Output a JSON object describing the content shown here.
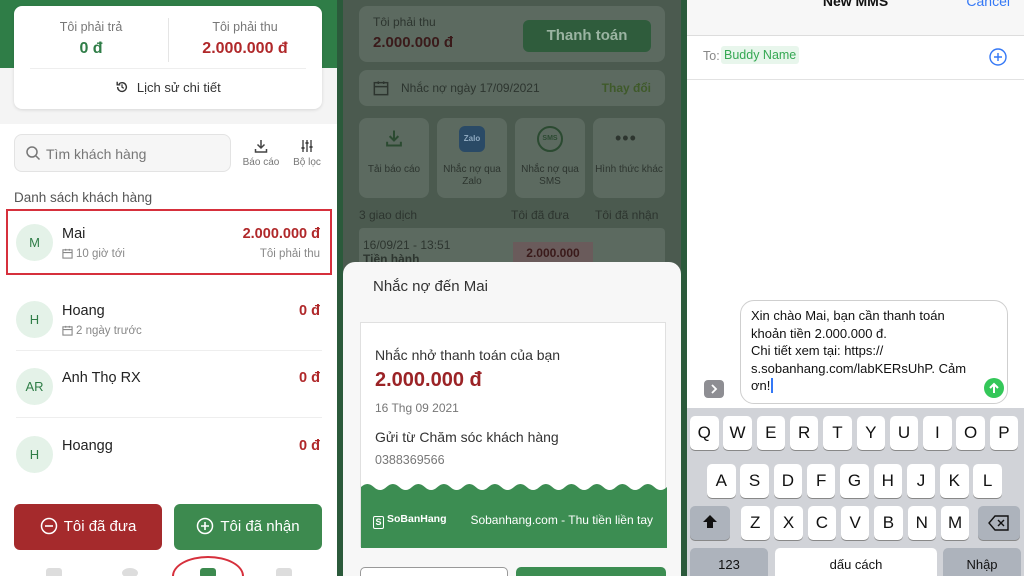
{
  "panel1": {
    "summary": {
      "pay_label": "Tôi phải trả",
      "pay_value": "0 đ",
      "receive_label": "Tôi phải thu",
      "receive_value": "2.000.000 đ",
      "history_label": "Lịch sử chi tiết"
    },
    "search_placeholder": "Tìm khách hàng",
    "tools": [
      {
        "label": "Báo cáo",
        "icon": "download-icon"
      },
      {
        "label": "Bộ lọc",
        "icon": "filter-icon"
      }
    ],
    "list_title": "Danh sách khách hàng",
    "customers": [
      {
        "initials": "M",
        "name": "Mai",
        "sub": "10 giờ tới",
        "amount": "2.000.000 đ",
        "note": "Tôi phải thu"
      },
      {
        "initials": "H",
        "name": "Hoang",
        "sub": "2 ngày trước",
        "amount": "0 đ"
      },
      {
        "initials": "AR",
        "name": "Anh Thọ RX",
        "amount": "0 đ"
      },
      {
        "initials": "H",
        "name": "Hoangg",
        "amount": "0 đ"
      }
    ],
    "buttons": {
      "gave": "Tôi đã đưa",
      "received": "Tôi đã nhận"
    },
    "colors": {
      "primary": "#2f7d47",
      "danger": "#b0282a",
      "highlight": "#d6303c"
    }
  },
  "panel2": {
    "bg": {
      "receive_label": "Tôi phải thu",
      "receive_value": "2.000.000 đ",
      "pay_button": "Thanh toán",
      "reminder_date": "Nhắc nợ ngày 17/09/2021",
      "change": "Thay đổi",
      "actions": [
        {
          "label": "Tải báo cáo",
          "icon": "download-icon"
        },
        {
          "label": "Nhắc nợ qua Zalo",
          "icon": "zalo-icon"
        },
        {
          "label": "Nhắc nợ qua SMS",
          "icon": "sms-icon"
        },
        {
          "label": "Hình thức khác",
          "icon": "more-icon"
        }
      ],
      "cols": [
        "3 giao dịch",
        "Tôi đã đưa",
        "Tôi đã nhận"
      ],
      "tx_date": "16/09/21 - 13:51",
      "tx_label": "Tiền hành",
      "tx_amount": "2.000.000"
    },
    "modal": {
      "title": "Nhắc nợ đến Mai",
      "reminder": "Nhắc nhở thanh toán của bạn",
      "amount": "2.000.000 đ",
      "date": "16 Thg 09 2021",
      "from": "Gửi từ Chăm sóc khách hàng",
      "phone": "0388369566",
      "brand": "SoBanHang",
      "footer": "Sobanhang.com - Thu tiền liền tay"
    }
  },
  "panel3": {
    "title": "New MMS",
    "cancel": "Cancel",
    "to_label": "To:",
    "recipient": "Buddy Name",
    "message": [
      "Xin chào Mai, bạn cần thanh toán",
      "khoản tiền 2.000.000 đ.",
      "Chi tiết xem tại: https://",
      "s.sobanhang.com/labKERsUhP. Cảm",
      "ơn!"
    ],
    "keys_row1": [
      "Q",
      "W",
      "E",
      "R",
      "T",
      "Y",
      "U",
      "I",
      "O",
      "P"
    ],
    "keys_row2": [
      "A",
      "S",
      "D",
      "F",
      "G",
      "H",
      "J",
      "K",
      "L"
    ],
    "keys_row3": [
      "Z",
      "X",
      "C",
      "V",
      "B",
      "N",
      "M"
    ],
    "key_123": "123",
    "key_space": "dấu cách",
    "key_return": "Nhập"
  }
}
